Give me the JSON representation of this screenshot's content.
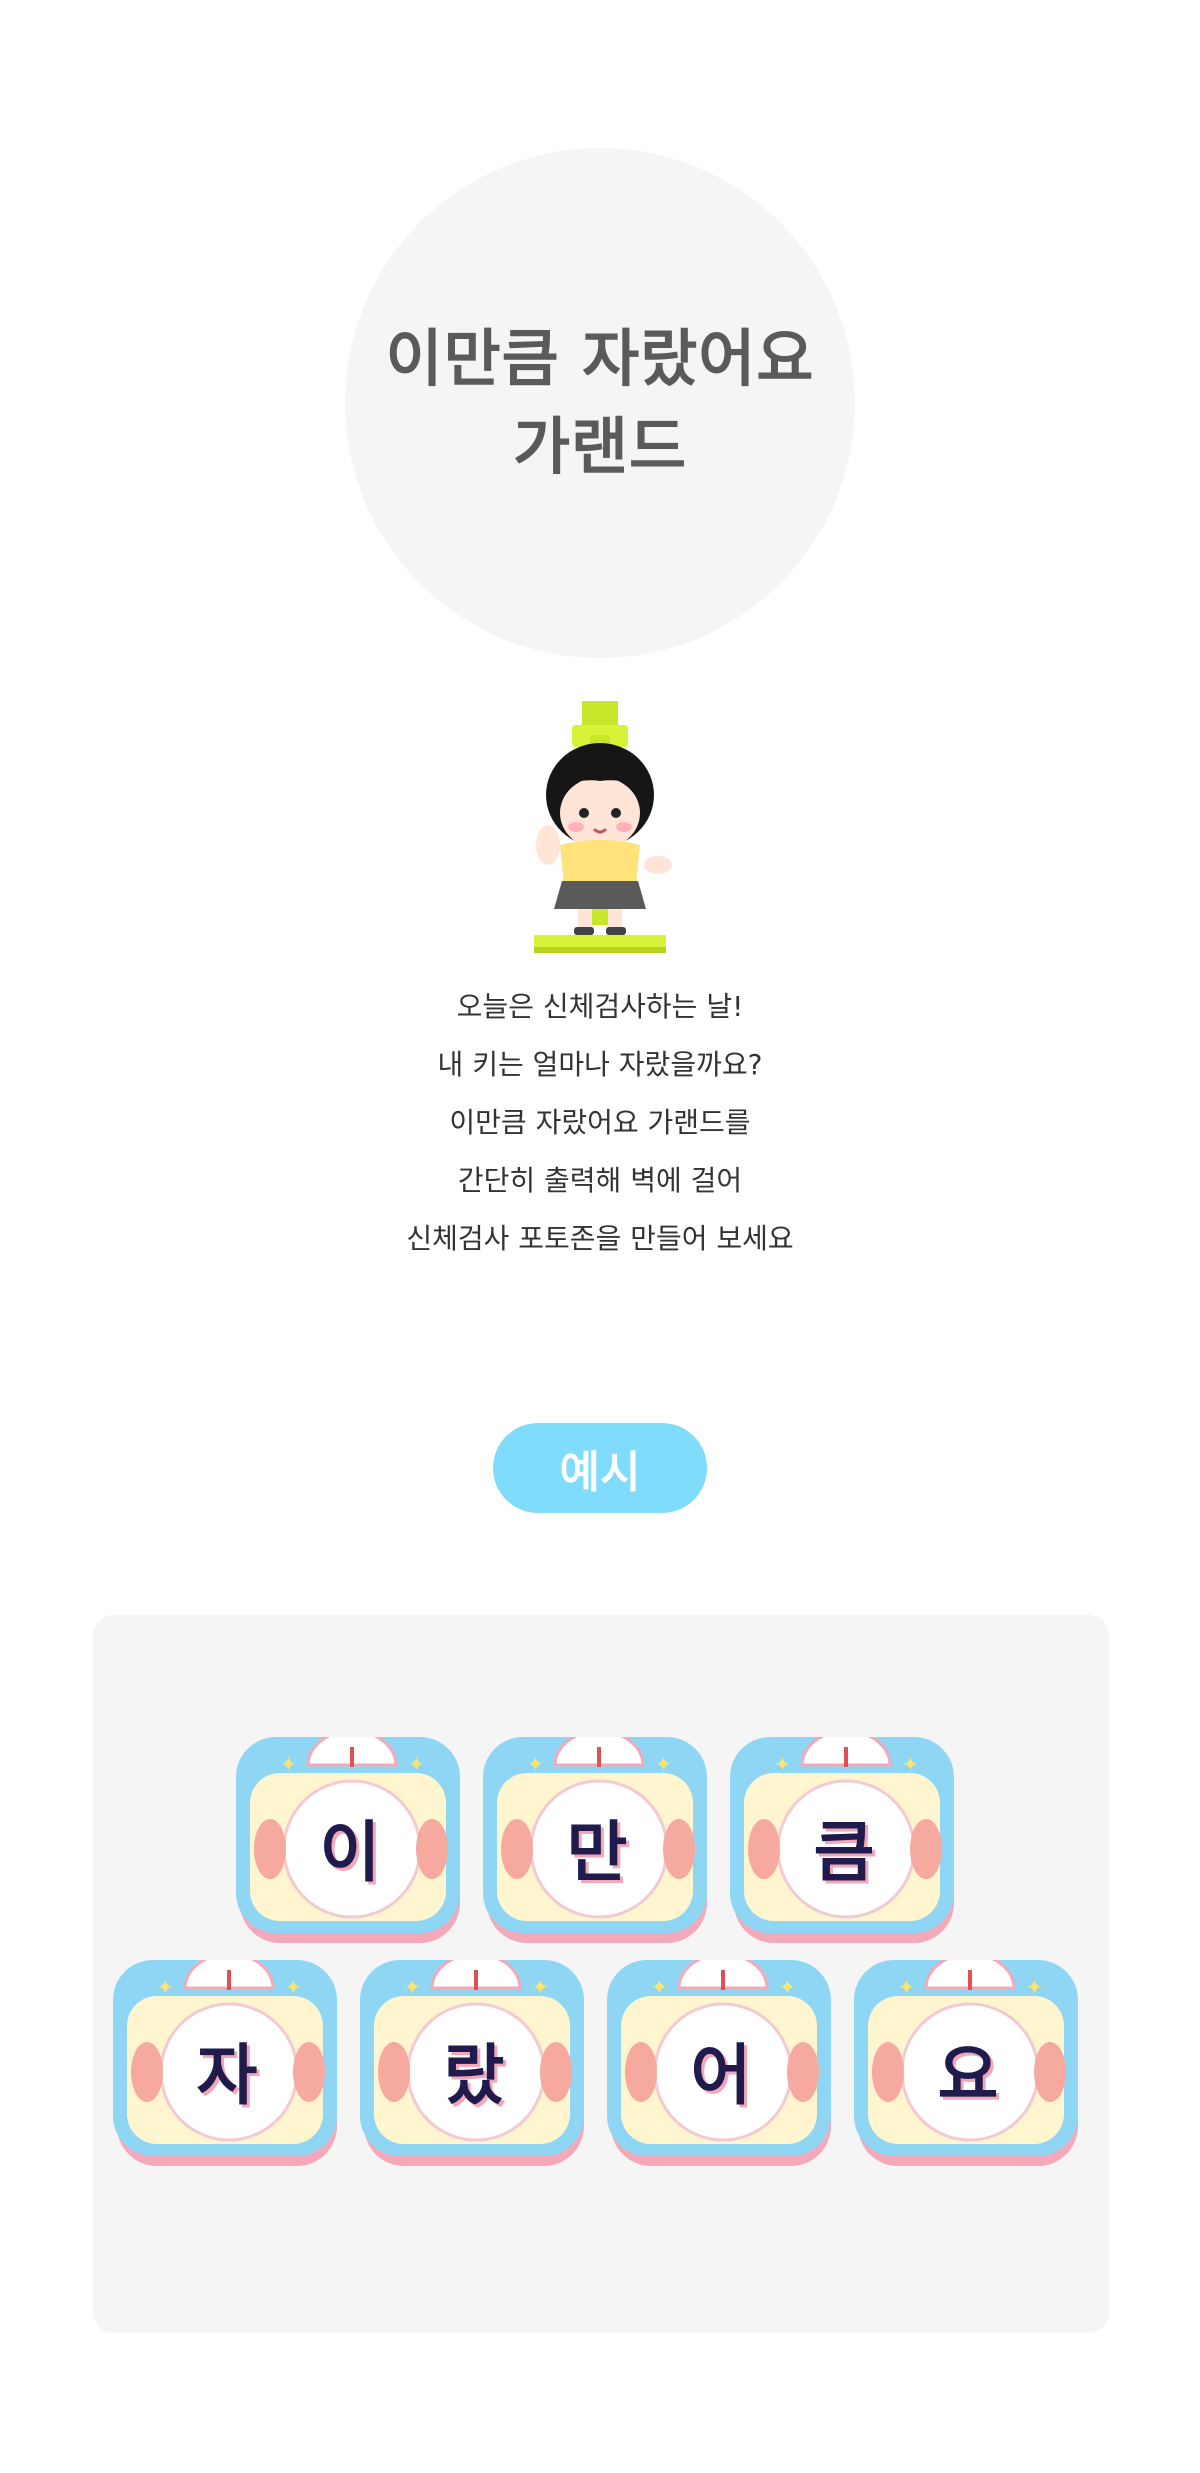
{
  "header": {
    "title_line1": "이만큼 자랐어요",
    "title_line2": "가랜드"
  },
  "description": {
    "lines": [
      "오늘은 신체검사하는 날!",
      "내 키는 얼마나 자랐을까요?",
      "이만큼 자랐어요 가랜드를",
      "간단히 출력해 벽에 걸어",
      "신체검사 포토존을 만들어 보세요"
    ]
  },
  "example": {
    "label": "예시",
    "cards": [
      "이",
      "만",
      "큼",
      "자",
      "랐",
      "어",
      "요"
    ]
  },
  "colors": {
    "pill": "#7fdcfb",
    "card_frame": "#8fd6f5",
    "card_inner": "#fff6cf",
    "card_shadow": "#f3a9b9",
    "foot": "#f5a99f",
    "letter": "#1f1b4d"
  },
  "icons": {
    "illustration": "child-on-height-scale-icon",
    "card_decor": "bathroom-scale-icon"
  }
}
